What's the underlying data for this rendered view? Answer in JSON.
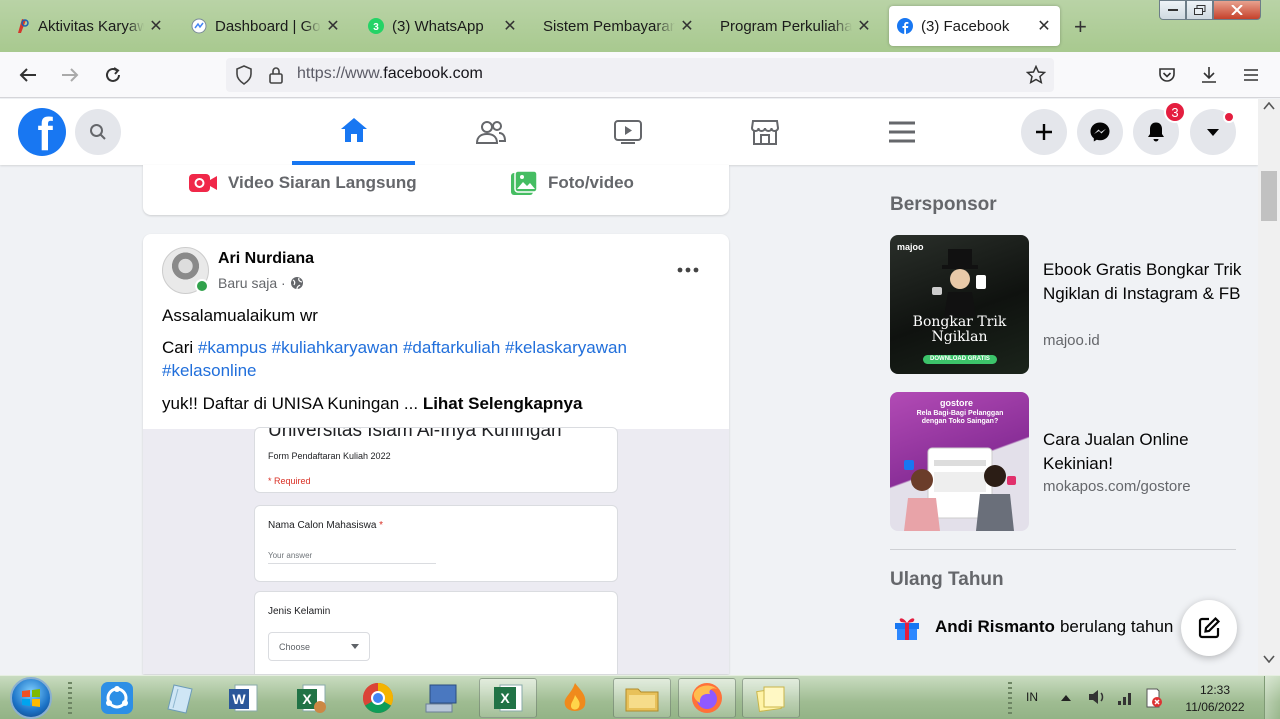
{
  "browser": {
    "tabs": [
      {
        "label": "Aktivitas Karyawan",
        "active": false
      },
      {
        "label": "Dashboard | Google",
        "active": false
      },
      {
        "label": "(3) WhatsApp",
        "active": false
      },
      {
        "label": "Sistem Pembayaran Mahasiswa",
        "active": false
      },
      {
        "label": "Program Perkuliahan Karyawan",
        "active": false
      },
      {
        "label": "(3) Facebook",
        "active": true
      }
    ],
    "close_glyph": "✕",
    "new_tab_glyph": "+",
    "url_prefix": "https://www.",
    "url_domain": "facebook.com"
  },
  "facebook": {
    "notification_count": "3",
    "composer": {
      "live_label": "Video Siaran Langsung",
      "photo_label": "Foto/video"
    },
    "post": {
      "author": "Ari Nurdiana",
      "time": "Baru saja ·",
      "greeting": "Assalamualaikum wr",
      "search_prefix": "Cari",
      "hashtags_line1": "#kampus #kuliahkaryawan #daftarkuliah #kelaskaryawan",
      "hashtags_line2": "#kelasonline",
      "cta_text": "yuk!! Daftar di UNISA Kuningan ...",
      "see_more": "Lihat Selengkapnya",
      "form": {
        "title": "Universitas Islam Al-Ihya Kuningan",
        "subtitle": "Form Pendaftaran Kuliah 2022",
        "required_note": "* Required",
        "q1_label": "Nama Calon Mahasiswa",
        "q1_star": "*",
        "q1_placeholder": "Your answer",
        "q2_label": "Jenis Kelamin",
        "q2_select": "Choose"
      }
    },
    "sidebar": {
      "sponsored_title": "Bersponsor",
      "ads": [
        {
          "title": "Ebook Gratis Bongkar Trik Ngiklan di Instagram & FB",
          "domain": "majoo.id"
        },
        {
          "title": "Cara Jualan Online Kekinian!",
          "domain": "mokapos.com/gostore"
        }
      ],
      "ad1_brand": "majoo",
      "ad1_headline": "Bongkar Trik Ngiklan",
      "ad1_cta": "DOWNLOAD GRATIS",
      "ad2_brand": "gostore",
      "ad2_headline": "Rela Bagi-Bagi Pelanggan dengan Toko Saingan?",
      "birthday_title": "Ulang Tahun",
      "birthday_name": "Andi Rismanto",
      "birthday_text": "berulang tahun"
    }
  },
  "taskbar": {
    "language": "IN",
    "time": "12:33",
    "date": "11/06/2022"
  },
  "colors": {
    "fb_blue": "#1877f2",
    "hashtag": "#216fdb",
    "badge_red": "#e41e3f",
    "online_green": "#31a24c"
  }
}
